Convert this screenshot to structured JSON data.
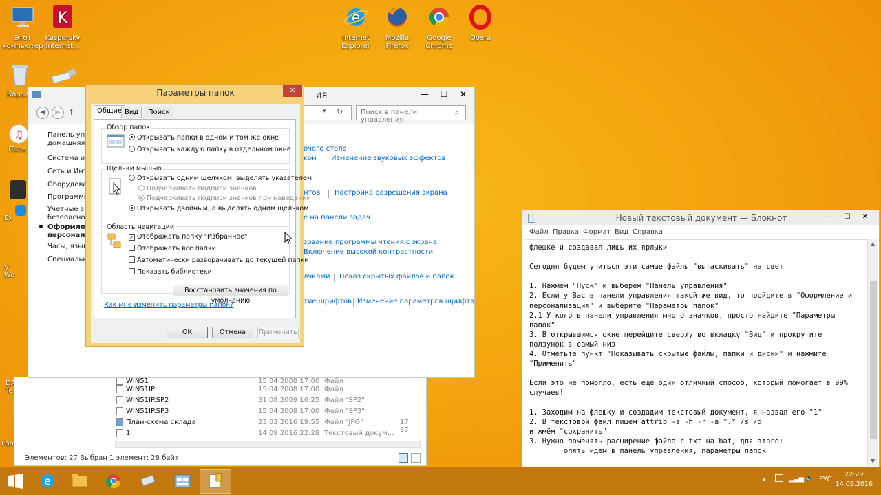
{
  "desktop": {
    "icons": [
      {
        "id": "this-pc",
        "label": "Этот компьютер"
      },
      {
        "id": "kaspersky",
        "label": "Kaspersky Internet..."
      },
      {
        "id": "ie",
        "label": "Internet Explorer"
      },
      {
        "id": "firefox",
        "label": "Mozilla Firefox"
      },
      {
        "id": "chrome",
        "label": "Google Chrome"
      },
      {
        "id": "opera",
        "label": "Opera"
      }
    ],
    "partial_labels": [
      "Корзи",
      "iTune",
      "Ex",
      "V\nWo",
      "DA\nTe",
      "Fore"
    ]
  },
  "control_panel": {
    "title_partial": "ия",
    "search_placeholder": "Поиск в панели управления",
    "left_items": [
      "Панель управ",
      "домашняя ст",
      "Система и бе",
      "Сеть и Интер",
      "Оборудован",
      "Программы",
      "Учетные запи",
      "безопасност",
      "Оформлени",
      "персонализа",
      "Часы, язык и",
      "Специальны"
    ],
    "links": [
      "очего стола",
      "Изменение звуковых эффектов",
      "кон",
      "нтов",
      "Настройка разрешения экрана",
      "е на панели задач",
      "зование программы чтения с экрана",
      "Включение высокой контрастности",
      "лчками",
      "Показ скрытых файлов и папок",
      "тие шрифтов",
      "Изменение параметров шрифта"
    ]
  },
  "explorer": {
    "rows": [
      {
        "name": "WIN51",
        "date": "15.04.2008 17:00",
        "type": "Файл",
        "size": ""
      },
      {
        "name": "WIN51IP",
        "date": "15.04.2008 17:00",
        "type": "Файл",
        "size": ""
      },
      {
        "name": "WIN51IP.SP2",
        "date": "31.08.2009 16:25",
        "type": "Файл \"SP2\"",
        "size": ""
      },
      {
        "name": "WIN51IP.SP3",
        "date": "15.04.2008 17:00",
        "type": "Файл \"SP3\"",
        "size": ""
      },
      {
        "name": "План-схема склада",
        "date": "23.03.2016 19:55",
        "type": "Файл \"JPG\"",
        "size": "17 37"
      },
      {
        "name": "1",
        "date": "14.09.2016 22:28",
        "type": "Текстовый докум...",
        "size": ""
      }
    ],
    "status_count": "Элементов: 27",
    "status_selected": "Выбран 1 элемент: 28 байт"
  },
  "folder_options": {
    "title": "Параметры папок",
    "close": "✕",
    "tabs": [
      "Общие",
      "Вид",
      "Поиск"
    ],
    "browse_group": "Обзор папок",
    "browse_same": "Открывать папки в одном и том же окне",
    "browse_new": "Открывать каждую папку в отдельном окне",
    "click_group": "Щелчки мышью",
    "click_single": "Открывать одним щелчком, выделять указателем",
    "underline_always": "Подчеркивать подписи значков",
    "underline_hover": "Подчеркивать подписи значков при наведении",
    "click_double": "Открывать двойным, а выделять одним щелчком",
    "nav_group": "Область навигации",
    "nav_favorites": "Отображать папку \"Избранное\"",
    "nav_all": "Отображать все папки",
    "nav_expand": "Автоматически разворачивать до текущей папки",
    "nav_libraries": "Показать библиотеки",
    "restore": "Восстановить значения по умолчанию",
    "help_link": "Как мне изменить параметры папок?",
    "ok": "ОК",
    "cancel": "Отмена",
    "apply": "Применить",
    "checkmark": "✓"
  },
  "notepad": {
    "title": "Новый текстовый документ — Блокнот",
    "menu": [
      "Файл",
      "Правка",
      "Формат",
      "Вид",
      "Справка"
    ],
    "text": "флешке и создавал лишь их ярлыки\n\nСегодня будем учиться эти самые файлы \"вытаскивать\" на свет\n\n1. Нажмём \"Пуск\" и выберем \"Панель управления\"\n2. Если у Вас в панели управления такой же вид, то пройдите в \"Оформление и\nперсонализация\" и выберите \"Параметры папок\"\n2.1 У кого в панели управления много значков, просто найдите \"Параметры\nпапок\"\n3. В открывшимся окне перейдите сверху во вкладку \"Вид\" и прокрутите\nползунок в самый низ\n4. Отметьте пункт \"Показывать скрытые файлы, папки и диски\" и нажмите\n\"Применить\"\n\nЕсли это не помогло, есть ещё один отличный способ, который помогает в 99%\nслучаев!\n\n1. Заходим на флешку и создадим текстовый документ, я назвал его \"1\"\n2. В текстовой файл пишем attrib -s -h -r -a *.* /s /d\nи жмём \"сохранить\"\n3. Нужно поменять расширение файла с txt на bat, для этого:\n        опять идём в панель управления, параметры папок",
    "controls": {
      "minimize": "—",
      "maximize": "☐",
      "close": "✕"
    }
  },
  "taskbar": {
    "lang": "РУС",
    "time": "22:29",
    "date": "14.09.2016"
  },
  "colors": {
    "desktop": "#f3a50e",
    "taskbar": "#c2780d",
    "dialog_frame": "#f6d27a",
    "link": "#0066cc"
  }
}
